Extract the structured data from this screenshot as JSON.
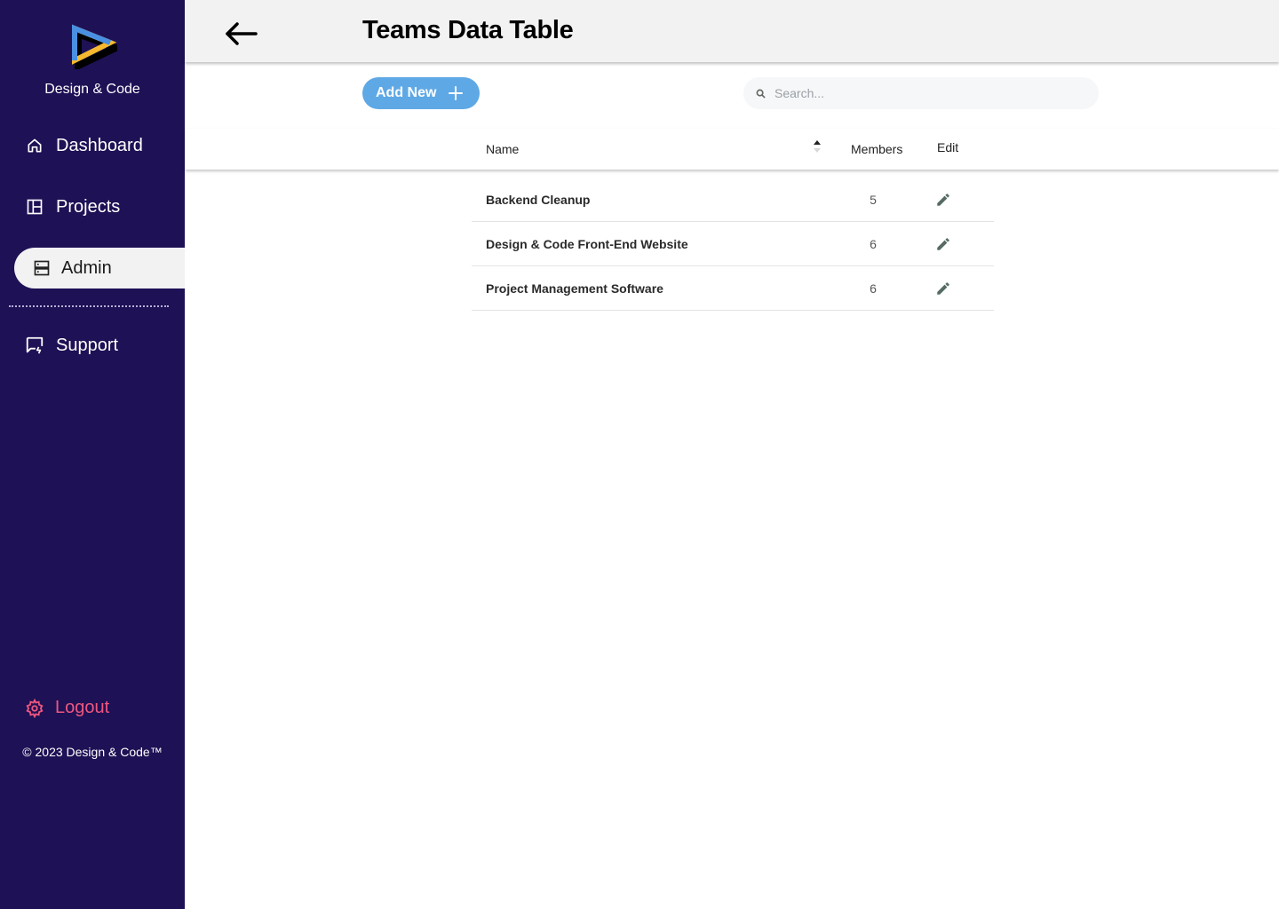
{
  "sidebar": {
    "brand": "Design & Code",
    "nav": [
      {
        "label": "Dashboard",
        "icon": "home-icon"
      },
      {
        "label": "Projects",
        "icon": "layout-icon"
      },
      {
        "label": "Admin",
        "icon": "server-icon",
        "active": true
      },
      {
        "label": "Support",
        "icon": "chat-icon"
      }
    ],
    "logout": "Logout",
    "copyright": "© 2023 Design & Code™"
  },
  "header": {
    "title": "Teams Data Table"
  },
  "toolbar": {
    "add_label": "Add New",
    "search_placeholder": "Search..."
  },
  "table": {
    "columns": [
      "Name",
      "Members",
      "Edit"
    ],
    "rows": [
      {
        "name": "Backend Cleanup",
        "members": "5"
      },
      {
        "name": "Design & Code Front-End Website",
        "members": "6"
      },
      {
        "name": "Project Management Software",
        "members": "6"
      }
    ]
  },
  "colors": {
    "sidebar_bg": "#1e1155",
    "accent": "#5ea8e6",
    "logout": "#f0577e"
  }
}
